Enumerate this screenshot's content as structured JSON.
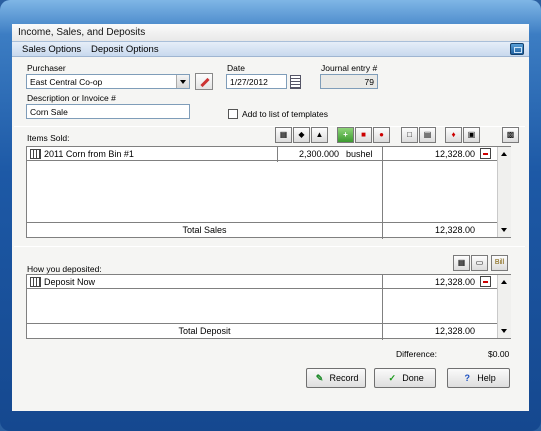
{
  "window": {
    "title": "Income, Sales, and Deposits"
  },
  "menu": {
    "items": [
      "Sales Options",
      "Deposit Options"
    ]
  },
  "form": {
    "purchaser_label": "Purchaser",
    "purchaser_value": "East Central Co-op",
    "date_label": "Date",
    "date_value": "1/27/2012",
    "journal_label": "Journal entry #",
    "journal_value": "79",
    "description_label": "Description or Invoice #",
    "description_value": "Corn Sale",
    "template_label": "Add to list of templates"
  },
  "items_sold": {
    "label": "Items Sold:",
    "rows": [
      {
        "description": "2011 Corn from Bin #1",
        "quantity": "2,300.000",
        "unit": "bushel",
        "amount": "12,328.00"
      }
    ],
    "total_label": "Total Sales",
    "total_value": "12,328.00"
  },
  "deposits": {
    "label": "How you deposited:",
    "rows": [
      {
        "description": "Deposit Now",
        "amount": "12,328.00"
      }
    ],
    "total_label": "Total Deposit",
    "total_value": "12,328.00",
    "bill_label": "Bill"
  },
  "difference": {
    "label": "Difference:",
    "value": "$0.00"
  },
  "buttons": {
    "record": "Record",
    "done": "Done",
    "help": "Help"
  },
  "colors": {
    "frame": "#1d59a6",
    "accent_red": "#c00000"
  }
}
